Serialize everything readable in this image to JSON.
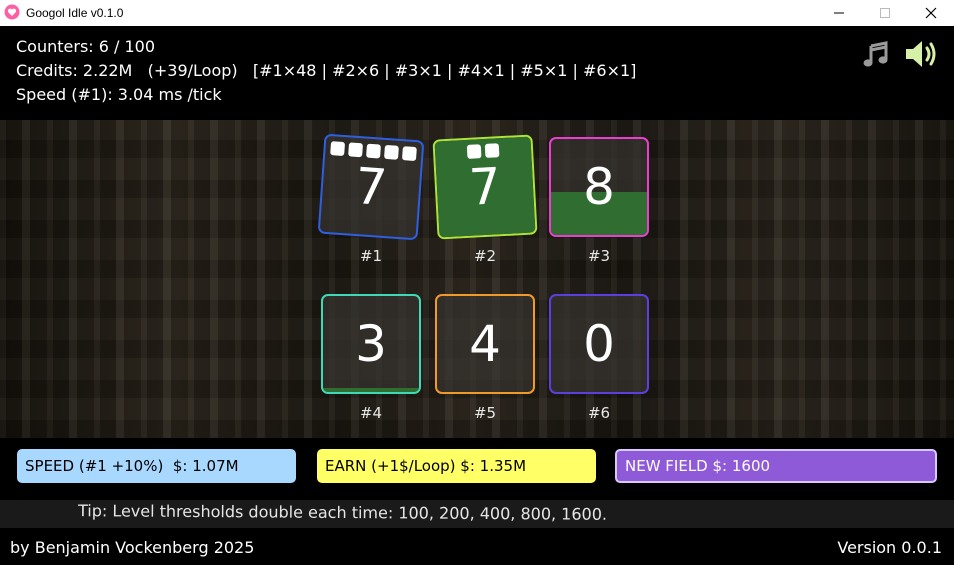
{
  "window": {
    "title": "Googol Idle v0.1.0",
    "icon": "heart-app-icon",
    "controls": [
      "minimize-icon",
      "maximize-icon",
      "close-icon"
    ]
  },
  "stats": {
    "counters": "Counters: 6 / 100",
    "credits": "Credits: 2.22M   (+39/Loop)   [#1×48 | #2×6 | #3×1 | #4×1 | #5×1 | #6×1]",
    "speed": "Speed (#1): 3.04 ms /tick"
  },
  "audio": {
    "music_icon": "music-note-icon",
    "volume_icon": "speaker-volume-icon"
  },
  "counters": [
    {
      "label": "#1",
      "digit": "7",
      "border": "#2f5fe0",
      "pips": 5,
      "fill_fraction": 0,
      "fill_color": "#2e7d32",
      "rotation_deg": 4
    },
    {
      "label": "#2",
      "digit": "7",
      "border": "#aee33a",
      "pips": 2,
      "fill_fraction": 1,
      "fill_color": "#2f6e30",
      "rotation_deg": -3
    },
    {
      "label": "#3",
      "digit": "8",
      "border": "#e83fd1",
      "pips": 0,
      "fill_fraction": 0.45,
      "fill_color": "#2f6e30",
      "rotation_deg": 0
    },
    {
      "label": "#4",
      "digit": "3",
      "border": "#3fd9b8",
      "pips": 0,
      "fill_fraction": 0.04,
      "fill_color": "#2f6e30",
      "rotation_deg": 0
    },
    {
      "label": "#5",
      "digit": "4",
      "border": "#f09a2a",
      "pips": 0,
      "fill_fraction": 0,
      "fill_color": "#2f6e30",
      "rotation_deg": 0
    },
    {
      "label": "#6",
      "digit": "0",
      "border": "#5b3fe0",
      "pips": 0,
      "fill_fraction": 0,
      "fill_color": "#2f6e30",
      "rotation_deg": 0
    }
  ],
  "upgrades": {
    "speed": {
      "label": "SPEED (#1 +10%)  $: 1.07M",
      "color": "#a9d8ff"
    },
    "earn": {
      "label": "EARN (+1$/Loop) $: 1.35M",
      "color": "#ffff66"
    },
    "new_field": {
      "label": "NEW FIELD $: 1600",
      "color": "#8e5ad8"
    }
  },
  "tip": "Tip: Level thresholds double each time: 100, 200, 400, 800, 1600.",
  "footer": {
    "author": "by Benjamin Vockenberg 2025",
    "version": "Version 0.0.1"
  }
}
